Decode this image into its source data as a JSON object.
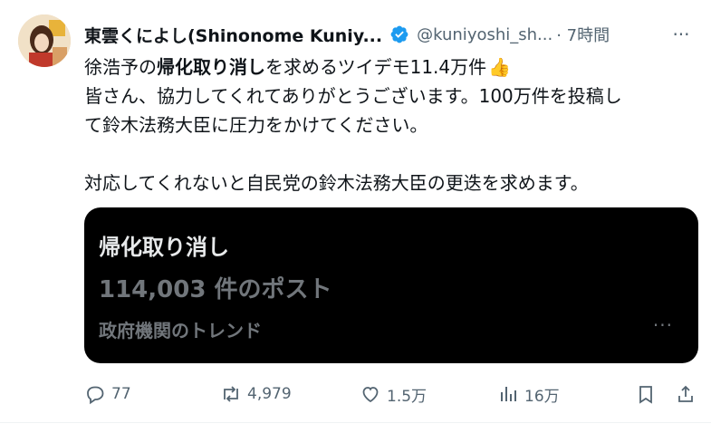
{
  "tweet": {
    "author_name": "東雲くによし(Shinonome Kuniy...",
    "handle": "@kuniyoshi_sh...",
    "time": "· 7時間",
    "more_label": "···",
    "text": {
      "line1_pre": "徐浩予の",
      "line1_bold": "帰化取り消し",
      "line1_post": "を求めるツイデモ11.4万件",
      "line1_emoji": "👍",
      "line2": "皆さん、協力してくれてありがとうございます。100万件を投稿し",
      "line3": "て鈴木法務大臣に圧力をかけてください。",
      "line4": "対応してくれないと自民党の鈴木法務大臣の更迭を求めます。"
    },
    "card": {
      "title": "帰化取り消し",
      "count": "114,003 件のポスト",
      "category": "政府機関のトレンド",
      "more_label": "···"
    },
    "actions": {
      "replies": "77",
      "retweets": "4,979",
      "likes": "1.5万",
      "views": "16万"
    }
  },
  "colors": {
    "text": "#0f1419",
    "secondary": "#536471",
    "verified": "#1d9bf0",
    "card_bg": "#000000"
  },
  "icons": [
    "verified-badge-icon",
    "more-icon",
    "reply-icon",
    "retweet-icon",
    "like-icon",
    "views-icon",
    "bookmark-icon",
    "share-icon"
  ]
}
